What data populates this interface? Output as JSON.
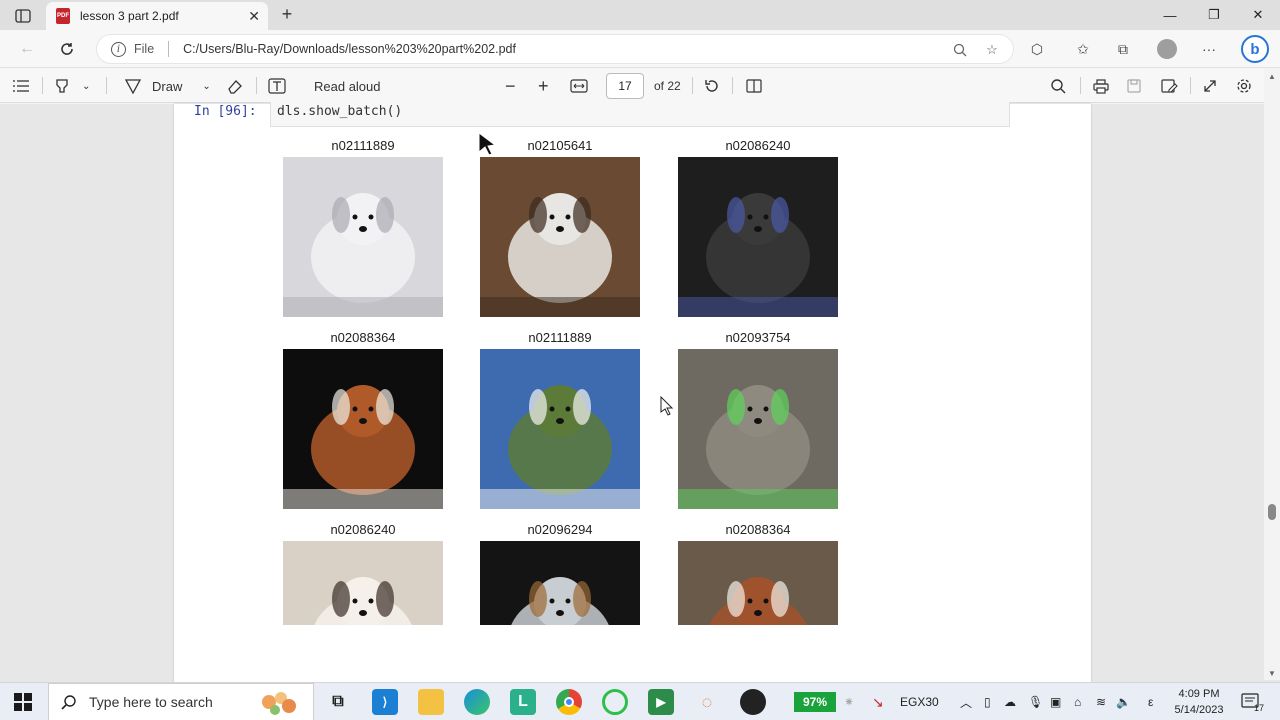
{
  "browser": {
    "tab_title": "lesson 3 part 2.pdf",
    "tab_icon_label": "PDF",
    "new_tab_label": "+",
    "address_prefix": "File",
    "url": "C:/Users/Blu-Ray/Downloads/lesson%203%20part%202.pdf"
  },
  "pdf_toolbar": {
    "draw_label": "Draw",
    "read_aloud_label": "Read aloud",
    "page_current": "17",
    "page_total": "of 22"
  },
  "notebook": {
    "prompt": "In [96]:",
    "code": "dls.show_batch()"
  },
  "batch": [
    {
      "label": "n02111889",
      "subject": "white samoyed lying on tiles",
      "colors": [
        "#d8d8dc",
        "#f2f2f4",
        "#a9a9b0"
      ]
    },
    {
      "label": "n02105641",
      "subject": "old english sheepdog standing",
      "colors": [
        "#6a4a32",
        "#e8e6e2",
        "#3a2a1e"
      ]
    },
    {
      "label": "n02086240",
      "subject": "black dog on patterned blanket",
      "colors": [
        "#1e1e1e",
        "#3a3a3a",
        "#4a5aa8"
      ]
    },
    {
      "label": "n02088364",
      "subject": "beagle on dark background",
      "colors": [
        "#0d0d0d",
        "#b05a2a",
        "#f0ece6"
      ]
    },
    {
      "label": "n02111889",
      "subject": "person with two white dogs outdoors",
      "colors": [
        "#3e6ab0",
        "#5c7a38",
        "#f4f4f2"
      ]
    },
    {
      "label": "n02093754",
      "subject": "shaggy terrier on green mat",
      "colors": [
        "#6e6a62",
        "#8f8a80",
        "#5cd45a"
      ]
    },
    {
      "label": "n02086240",
      "subject": "shih tzu face",
      "colors": [
        "#d9d1c5",
        "#f5f1ea",
        "#3a2e26"
      ]
    },
    {
      "label": "n02096294",
      "subject": "small dog on striped bed",
      "colors": [
        "#141414",
        "#c8cdd2",
        "#9a6a32"
      ]
    },
    {
      "label": "n02088364",
      "subject": "beagle puppy on ground",
      "colors": [
        "#6a5a4a",
        "#a0522d",
        "#f4f0e8"
      ]
    }
  ],
  "taskbar": {
    "search_placeholder": "Type here to search",
    "battery": "97%",
    "ticker": "EGX30",
    "time": "4:09 PM",
    "date": "5/14/2023",
    "notification_count": "17"
  },
  "icons": [
    "sidebar-icon",
    "pdf-icon",
    "close-icon",
    "back-icon",
    "refresh-icon",
    "info-icon",
    "zoom-icon",
    "favorite-add-icon",
    "extensions-icon",
    "favorites-icon",
    "collections-icon",
    "profile-icon",
    "more-icon",
    "bing-icon",
    "contents-icon",
    "highlight-icon",
    "draw-icon",
    "eraser-icon",
    "text-icon",
    "zoom-out-icon",
    "zoom-in-icon",
    "fit-page-icon",
    "rotate-icon",
    "page-view-icon",
    "search-icon",
    "print-icon",
    "save-icon",
    "save-as-icon",
    "fullscreen-icon",
    "settings-icon",
    "windows-icon",
    "task-view-icon",
    "vscode-icon",
    "file-explorer-icon",
    "edge-icon",
    "chrome-icon"
  ]
}
